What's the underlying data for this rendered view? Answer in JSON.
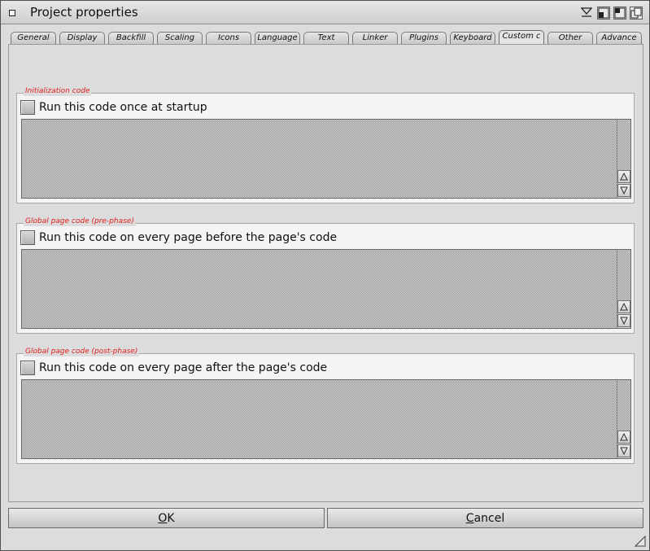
{
  "window": {
    "title": "Project properties"
  },
  "title_gadgets": [
    "iconify-icon",
    "zoom-icon",
    "size-icon",
    "depth-icon"
  ],
  "tabs": [
    {
      "label": "General"
    },
    {
      "label": "Display"
    },
    {
      "label": "Backfill"
    },
    {
      "label": "Scaling"
    },
    {
      "label": "Icons"
    },
    {
      "label": "Language"
    },
    {
      "label": "Text"
    },
    {
      "label": "Linker"
    },
    {
      "label": "Plugins"
    },
    {
      "label": "Keyboard"
    },
    {
      "label": "Custom c",
      "active": true
    },
    {
      "label": "Other"
    },
    {
      "label": "Advance"
    }
  ],
  "groups": [
    {
      "title": "Initialization code",
      "checkbox_label": "Run this code once at startup",
      "checked": false
    },
    {
      "title": "Global page code (pre-phase)",
      "checkbox_label": "Run this code on every page before the page's code",
      "checked": false
    },
    {
      "title": "Global page code (post-phase)",
      "checkbox_label": "Run this code on every page after the page's code",
      "checked": false
    }
  ],
  "buttons": {
    "ok": {
      "hotkey": "O",
      "rest": "K"
    },
    "cancel": {
      "hotkey": "C",
      "rest": "ancel"
    }
  },
  "colors": {
    "group_title": "#e02020",
    "window_bg": "#dcdcdc"
  }
}
